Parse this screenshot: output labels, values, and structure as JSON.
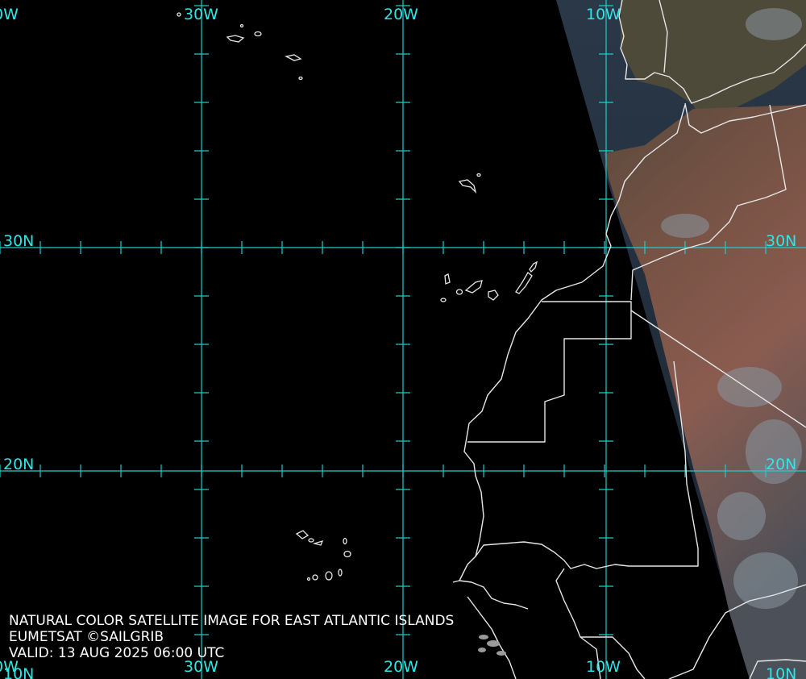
{
  "grid": {
    "labels_top": [
      "0W",
      "30W",
      "20W",
      "10W"
    ],
    "labels_bottom": [
      "0W",
      "30W",
      "20W",
      "10W"
    ],
    "labels_left": [
      "30N",
      "20N",
      "10N"
    ],
    "labels_right": [
      "30N",
      "20N",
      "10N"
    ],
    "line_color": "#20cccc"
  },
  "caption": {
    "title": "NATURAL COLOR SATELLITE IMAGE FOR EAST ATLANTIC ISLANDS",
    "source": "EUMETSAT ©SAILGRIB",
    "valid": "VALID:  13 AUG 2025 06:00 UTC"
  },
  "colors": {
    "ocean": "#000000",
    "land_desert": "#8a5a4c",
    "land_dark": "#4a3a32",
    "sea_imaged": "#1a2a3a",
    "coastline": "#e0e0e0"
  }
}
